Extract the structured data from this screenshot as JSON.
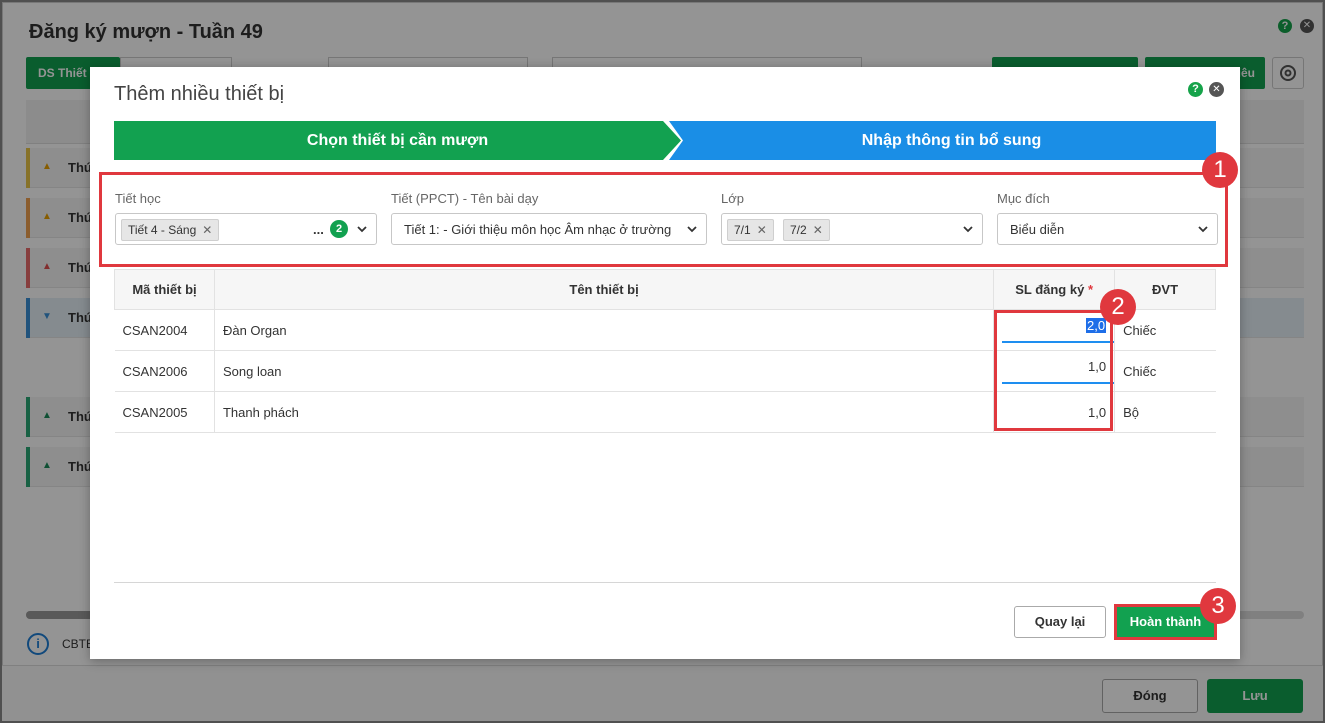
{
  "background": {
    "title": "Đăng ký mượn - Tuần 49",
    "tab_active": "DS Thiết",
    "btn_partial": "iêu",
    "row_label": "Thứ",
    "info_text": "CBTB",
    "close_button": "Đóng",
    "save_button": "Lưu"
  },
  "modal": {
    "title": "Thêm nhiều thiết bị",
    "help": "?",
    "close": "✕",
    "steps": [
      {
        "label": "Chọn thiết bị cần mượn",
        "color": "#12a150"
      },
      {
        "label": "Nhập thông tin bổ sung",
        "color": "#1a8ee6"
      }
    ],
    "filters": {
      "period": {
        "label": "Tiết học",
        "chip": "Tiết 4 - Sáng",
        "more": "...",
        "count": "2"
      },
      "lesson": {
        "label": "Tiết (PPCT) - Tên bài dạy",
        "value": "Tiết 1: - Giới thiệu môn học Âm nhạc ở trường"
      },
      "class": {
        "label": "Lớp",
        "chips": [
          "7/1",
          "7/2"
        ]
      },
      "purpose": {
        "label": "Mục đích",
        "value": "Biểu diễn"
      }
    },
    "table": {
      "headers": [
        "Mã thiết bị",
        "Tên thiết bị",
        "SL đăng ký",
        "ĐVT"
      ],
      "required_mark": "*",
      "rows": [
        {
          "code": "CSAN2004",
          "name": "Đàn Organ",
          "qty": "2,0",
          "unit": "Chiếc"
        },
        {
          "code": "CSAN2006",
          "name": "Song loan",
          "qty": "1,0",
          "unit": "Chiếc"
        },
        {
          "code": "CSAN2005",
          "name": "Thanh phách",
          "qty": "1,0",
          "unit": "Bộ"
        }
      ]
    },
    "back_button": "Quay lại",
    "finish_button": "Hoàn thành"
  },
  "annotations": [
    "1",
    "2",
    "3"
  ],
  "colors": {
    "accent_green": "#12a150",
    "step_blue": "#1a8ee6",
    "highlight_red": "#e0383e"
  }
}
